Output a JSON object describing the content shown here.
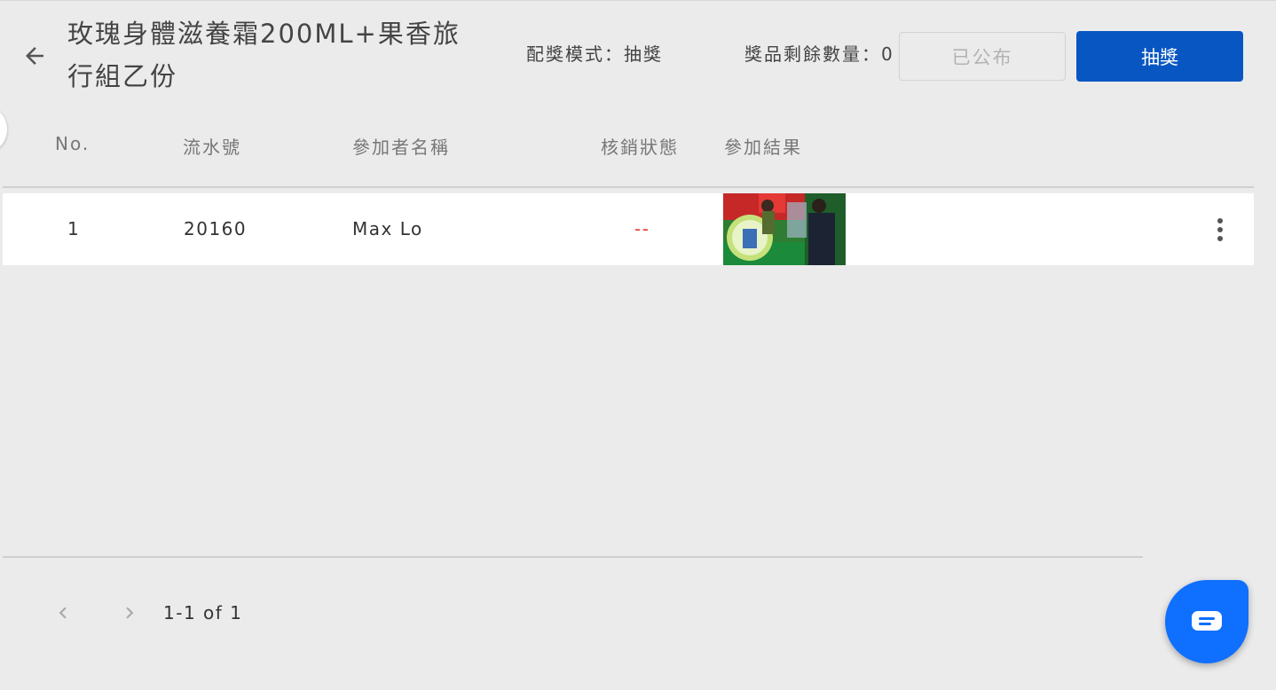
{
  "header": {
    "title": "玫瑰身體滋養霜200ML+果香旅行組乙份",
    "mode_label": "配獎模式：抽獎",
    "remaining_label": "獎品剩餘數量：0",
    "published_button": "已公布",
    "draw_button": "抽獎"
  },
  "table": {
    "columns": [
      "No.",
      "流水號",
      "參加者名稱",
      "核銷狀態",
      "參加結果"
    ],
    "rows": [
      {
        "no": "1",
        "serial": "20160",
        "participant": "Max Lo",
        "status": "--"
      }
    ]
  },
  "pagination": {
    "range_text": "1-1 of 1"
  },
  "colors": {
    "primary": "#0756c2",
    "chat": "#0f6fff",
    "status_red": "#e53935",
    "background": "#ebebeb"
  },
  "icons": {
    "back": "arrow-left-icon",
    "more": "more-vert-icon",
    "prev": "chevron-left-icon",
    "next": "chevron-right-icon",
    "chat": "chat-icon"
  }
}
